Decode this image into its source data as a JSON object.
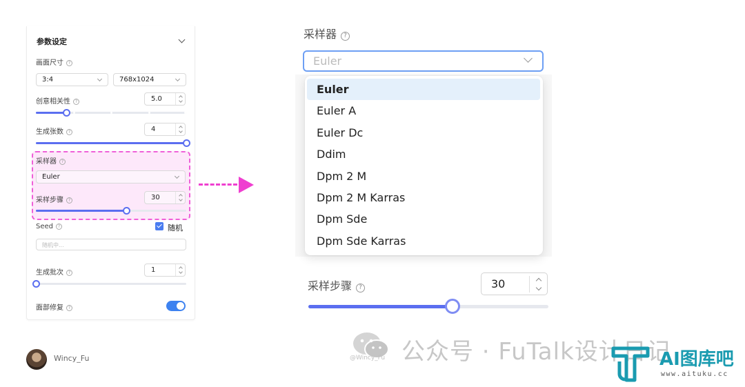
{
  "panel": {
    "title": "参数设定",
    "canvas_size_label": "画面尺寸",
    "ratio_value": "3:4",
    "resolution_value": "768x1024",
    "relevance_label": "创意相关性",
    "relevance_value": "5.0",
    "relevance_level": 0.2,
    "count_label": "生成张数",
    "count_value": "4",
    "count_level": 1.0,
    "sampler_label": "采样器",
    "sampler_value": "Euler",
    "steps_label": "采样步骤",
    "steps_value": "30",
    "steps_level": 0.6,
    "seed_label": "Seed",
    "random_label": "随机",
    "random_checked": true,
    "seed_placeholder": "随机中...",
    "batch_label": "生成批次",
    "batch_value": "1",
    "batch_level": 0.0,
    "face_fix_label": "面部修复",
    "face_fix_on": true
  },
  "detail": {
    "sampler_label": "采样器",
    "sampler_placeholder": "Euler",
    "options": [
      "Euler",
      "Euler A",
      "Euler Dc",
      "Ddim",
      "Dpm 2 M",
      "Dpm 2 M Karras",
      "Dpm Sde",
      "Dpm Sde Karras"
    ],
    "selected_index": 0,
    "steps_label": "采样步骤",
    "steps_value": "30",
    "steps_level": 0.6
  },
  "colors": {
    "accent": "#5b6ef0",
    "highlight": "#ef5fd8",
    "arrow": "#ef3fd0",
    "toggle": "#3d82f0"
  },
  "footer": {
    "author": "Wincy_Fu",
    "watermark": "公众号 · FuTalk设计日记",
    "watermark_handle": "@Wincy_Fu",
    "logo_text": "AI图库吧",
    "logo_url": "www.aituku.cc"
  }
}
